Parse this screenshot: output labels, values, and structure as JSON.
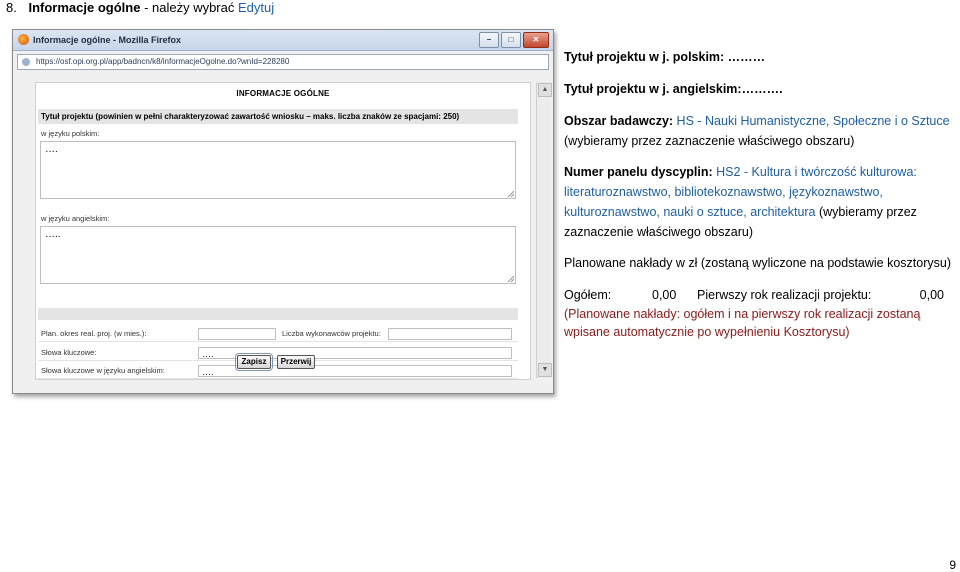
{
  "heading": {
    "number": "8.",
    "title": "Informacje ogólne",
    "dash": "- należy wybrać",
    "link": "Edytuj"
  },
  "window": {
    "title": "Informacje ogólne - Mozilla Firefox",
    "url": "https://osf.opi.org.pl/app/badncn/k8/informacjeOgolne.do?wnId=228280",
    "buttons": {
      "minimize": "–",
      "maximize": "□",
      "close": "✕"
    }
  },
  "form": {
    "title": "INFORMACJE OGÓLNE",
    "project_title_label": "Tytuł projektu (powinien w pełni charakteryzować zawartość wniosku – maks. liczba znaków ze spacjami: 250)",
    "pl_label": "w języku polskim:",
    "pl_value": "….",
    "en_label": "w języku angielskim:",
    "en_value": "…..",
    "period_label": "Plan. okres real. proj. (w mies.):",
    "performers_label": "Liczba wykonawców projektu:",
    "keywords_label": "Słowa kluczowe:",
    "keywords_value": "….",
    "keywords_en_label": "Słowa kluczowe w języku angielskim:",
    "keywords_en_value": "….",
    "save_label": "Zapisz",
    "cancel_label": "Przerwij"
  },
  "right": {
    "title_pl": "Tytuł projektu w j. polskim: ………",
    "title_en": "Tytuł projektu w j. angielskim:……….",
    "area_prefix": "Obszar badawczy: ",
    "area_value": "HS - Nauki Humanistyczne, Społeczne i o Sztuce",
    "area_note": "(wybieramy przez zaznaczenie właściwego obszaru)",
    "panel_prefix": "Numer panelu dyscyplin: ",
    "panel_line1": "HS2 - Kultura i twórczość kulturowa:",
    "panel_line2": "literaturoznawstwo, bibliotekoznawstwo, językoznawstwo,",
    "panel_line3": "kulturoznawstwo, nauki o sztuce, architektura",
    "panel_note_a": " (wybieramy przez",
    "panel_note_b": "zaznaczenie właściwego obszaru)",
    "costs": "Planowane nakłady w zł (zostaną wyliczone na podstawie kosztorysu)",
    "total_label": "Ogółem:",
    "total_value": "0,00",
    "first_year_label": "Pierwszy rok realizacji projektu:",
    "first_year_value": "0,00",
    "auto_note_1": "(Planowane nakłady: ogółem i na pierwszy rok realizacji zostaną",
    "auto_note_2": "wpisane automatycznie po wypełnieniu Kosztorysu)"
  },
  "page_number": "9",
  "colors": {
    "accent": "#1f5fa6",
    "red_note": "#8b1a1a"
  }
}
